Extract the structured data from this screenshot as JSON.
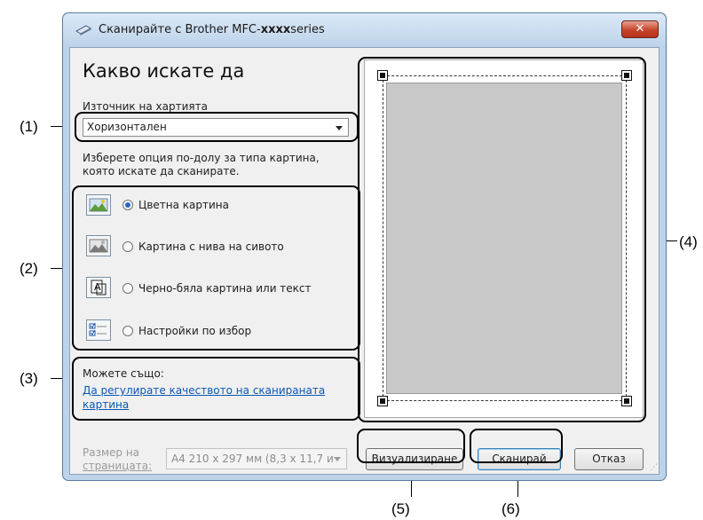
{
  "window": {
    "title_prefix": "Сканирайте с Brother MFC-",
    "title_bold": "xxxx",
    "title_suffix": "series",
    "close_label": "✕"
  },
  "heading": "Какво искате да",
  "paper_source": {
    "label": "Източник на хартията",
    "value": "Хоризонтален"
  },
  "picture_type_prompt_line1": "Изберете опция по-долу за типа картина,",
  "picture_type_prompt_line2": "която искате да сканирате.",
  "options": [
    {
      "label": "Цветна картина",
      "selected": true,
      "icon": "color-picture-icon"
    },
    {
      "label": "Картина с нива на сивото",
      "selected": false,
      "icon": "grayscale-picture-icon"
    },
    {
      "label": "Черно-бяла картина или текст",
      "selected": false,
      "icon": "black-white-text-icon"
    },
    {
      "label": "Настройки по избор",
      "selected": false,
      "icon": "custom-settings-icon"
    }
  ],
  "also": {
    "label": "Можете също:",
    "link_line1": "Да регулирате качеството на сканираната",
    "link_line2": "картина"
  },
  "page_size": {
    "label_line1": "Размер на",
    "label_line2": "страницата:",
    "value": "A4 210 x 297 мм (8,3 x 11,7 и"
  },
  "buttons": {
    "preview": "Визуализиране",
    "scan": "Сканирай",
    "cancel": "Отказ"
  },
  "callouts": [
    "(1)",
    "(2)",
    "(3)",
    "(4)",
    "(5)",
    "(6)"
  ],
  "colors": {
    "link": "#0b57b5",
    "radio_selected": "#2a62c9",
    "close_button": "#c7442a"
  }
}
